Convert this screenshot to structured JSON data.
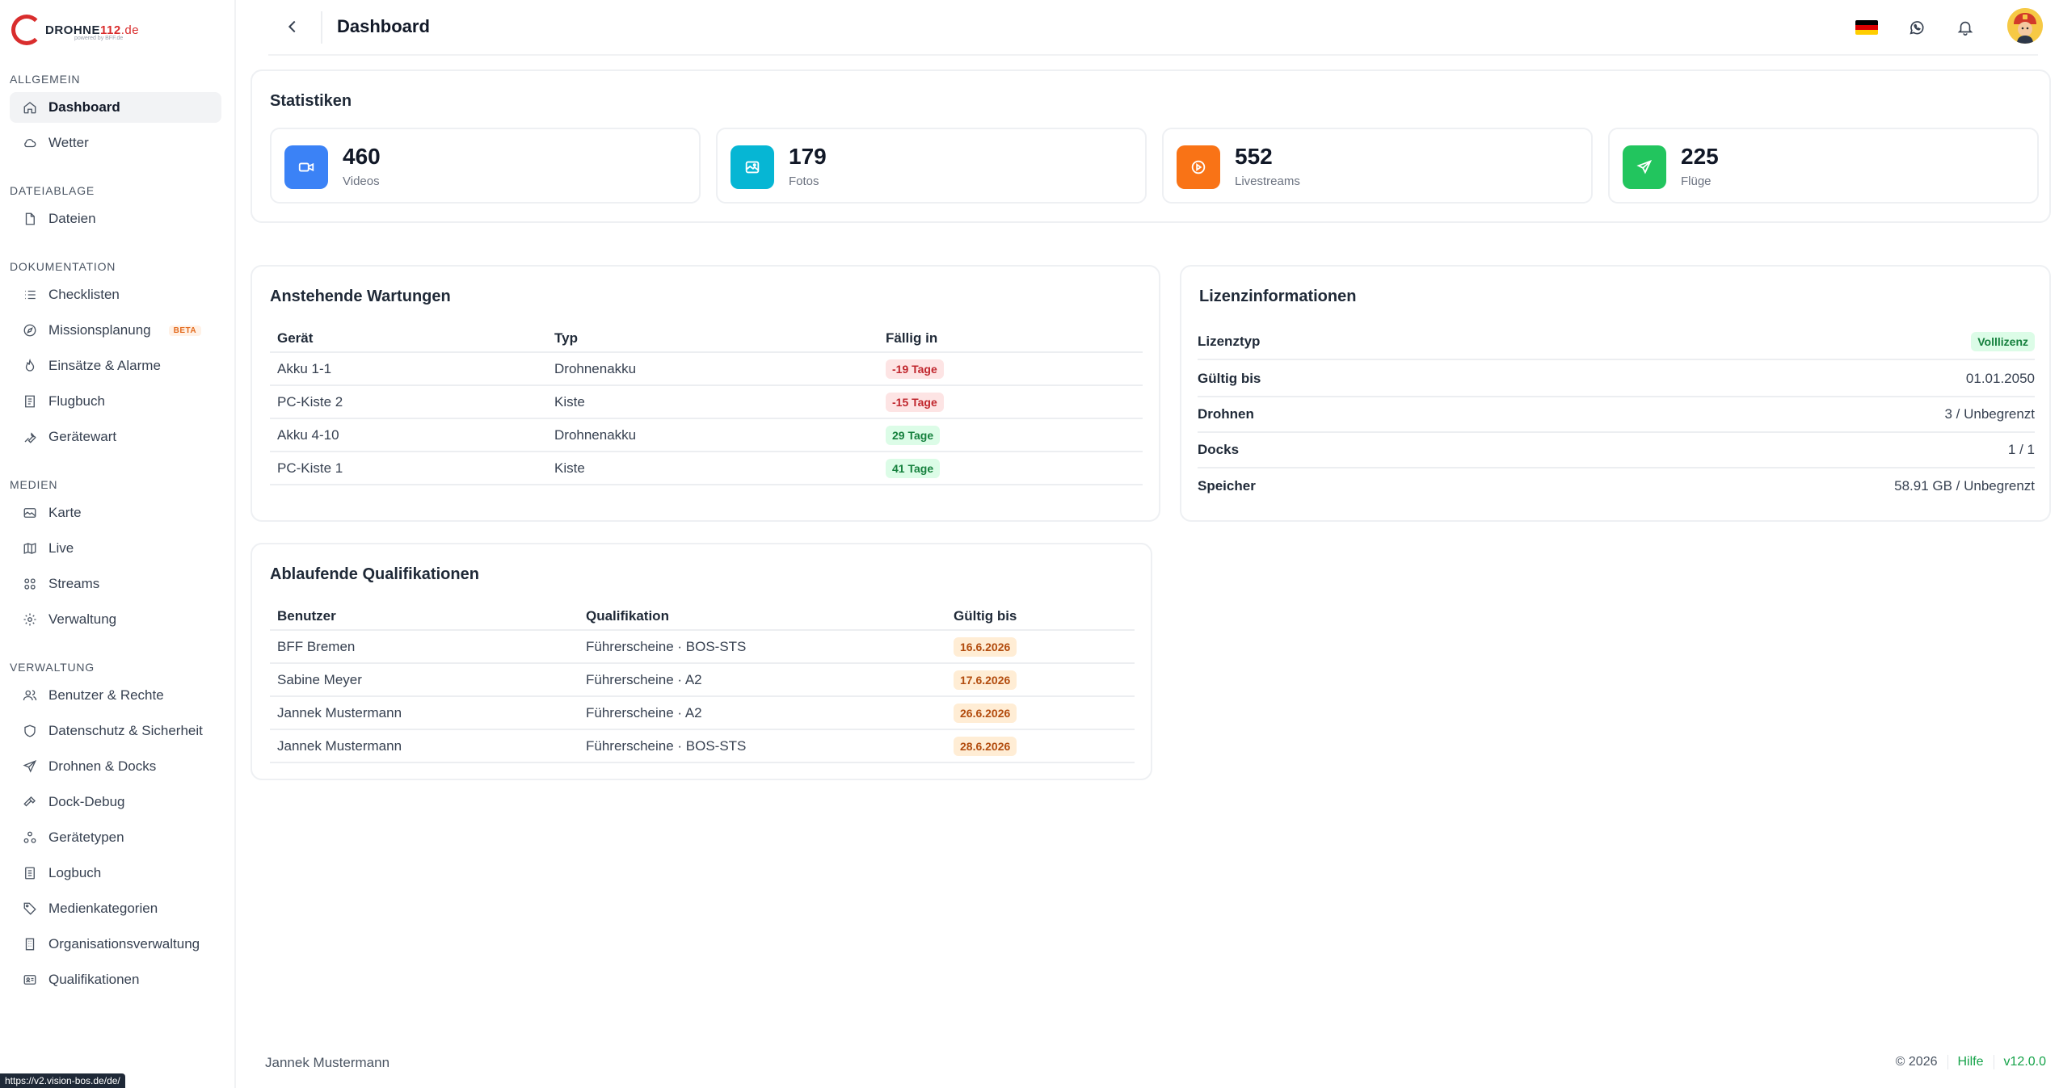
{
  "brand": {
    "logo_text_dark": "DROHNE",
    "logo_text_red": "112",
    "logo_text_suffix": ".de",
    "logo_sub": "powered by BFF.de"
  },
  "sidebar": {
    "sections": [
      {
        "title": "Allgemein",
        "items": [
          {
            "label": "Dashboard",
            "icon": "home-icon"
          },
          {
            "label": "Wetter",
            "icon": "cloud-icon"
          }
        ]
      },
      {
        "title": "Dateiablage",
        "items": [
          {
            "label": "Dateien",
            "icon": "file-icon"
          }
        ]
      },
      {
        "title": "Dokumentation",
        "items": [
          {
            "label": "Checklisten",
            "icon": "list-icon"
          },
          {
            "label": "Missionsplanung",
            "icon": "compass-icon",
            "badge": "BETA"
          },
          {
            "label": "Einsätze & Alarme",
            "icon": "flame-icon"
          },
          {
            "label": "Flugbuch",
            "icon": "book-icon"
          },
          {
            "label": "Gerätewart",
            "icon": "wrench-icon"
          }
        ]
      },
      {
        "title": "Medien",
        "items": [
          {
            "label": "Karte",
            "icon": "map-icon"
          },
          {
            "label": "Live",
            "icon": "map-fold-icon"
          },
          {
            "label": "Streams",
            "icon": "grid-icon"
          },
          {
            "label": "Verwaltung",
            "icon": "gear-icon"
          }
        ]
      },
      {
        "title": "Verwaltung",
        "items": [
          {
            "label": "Benutzer & Rechte",
            "icon": "users-icon"
          },
          {
            "label": "Datenschutz & Sicherheit",
            "icon": "shield-icon"
          },
          {
            "label": "Drohnen & Docks",
            "icon": "send-icon"
          },
          {
            "label": "Dock-Debug",
            "icon": "hammer-icon"
          },
          {
            "label": "Gerätetypen",
            "icon": "shapes-icon"
          },
          {
            "label": "Logbuch",
            "icon": "logbook-icon"
          },
          {
            "label": "Medienkategorien",
            "icon": "tag-icon"
          },
          {
            "label": "Organisationsverwaltung",
            "icon": "building-icon"
          },
          {
            "label": "Qualifikationen",
            "icon": "id-card-icon"
          }
        ]
      }
    ]
  },
  "header": {
    "title": "Dashboard"
  },
  "stats": {
    "title": "Statistiken",
    "items": [
      {
        "value": "460",
        "label": "Videos",
        "color": "#3b82f6",
        "icon": "video-icon"
      },
      {
        "value": "179",
        "label": "Fotos",
        "color": "#06b6d4",
        "icon": "image-icon"
      },
      {
        "value": "552",
        "label": "Livestreams",
        "color": "#f97316",
        "icon": "play-circle-icon"
      },
      {
        "value": "225",
        "label": "Flüge",
        "color": "#22c55e",
        "icon": "send-icon"
      }
    ]
  },
  "maintenance": {
    "title": "Anstehende Wartungen",
    "columns": [
      "Gerät",
      "Typ",
      "Fällig in"
    ],
    "rows": [
      {
        "device": "Akku 1-1",
        "type": "Drohnenakku",
        "due": "-19 Tage",
        "status": "red"
      },
      {
        "device": "PC-Kiste 2",
        "type": "Kiste",
        "due": "-15 Tage",
        "status": "red"
      },
      {
        "device": "Akku 4-10",
        "type": "Drohnenakku",
        "due": "29 Tage",
        "status": "green"
      },
      {
        "device": "PC-Kiste 1",
        "type": "Kiste",
        "due": "41 Tage",
        "status": "green"
      }
    ]
  },
  "license": {
    "title": "Lizenzinformationen",
    "rows": [
      {
        "key": "Lizenztyp",
        "value": "Volllizenz",
        "badge": true
      },
      {
        "key": "Gültig bis",
        "value": "01.01.2050"
      },
      {
        "key": "Drohnen",
        "value": "3 / Unbegrenzt"
      },
      {
        "key": "Docks",
        "value": "1 / 1"
      },
      {
        "key": "Speicher",
        "value": "58.91 GB / Unbegrenzt"
      }
    ]
  },
  "qualifications": {
    "title": "Ablaufende Qualifikationen",
    "columns": [
      "Benutzer",
      "Qualifikation",
      "Gültig bis"
    ],
    "rows": [
      {
        "user": "BFF Bremen",
        "qualification": "Führerscheine · BOS-STS",
        "valid_until": "16.6.2026"
      },
      {
        "user": "Sabine Meyer",
        "qualification": "Führerscheine · A2",
        "valid_until": "17.6.2026"
      },
      {
        "user": "Jannek Mustermann",
        "qualification": "Führerscheine · A2",
        "valid_until": "26.6.2026"
      },
      {
        "user": "Jannek Mustermann",
        "qualification": "Führerscheine · BOS-STS",
        "valid_until": "28.6.2026"
      }
    ]
  },
  "footer": {
    "user": "Jannek Mustermann",
    "copyright": "© 2026",
    "help": "Hilfe",
    "version": "v12.0.0"
  },
  "status_bar": {
    "url": "https://v2.vision-bos.de/de/"
  }
}
